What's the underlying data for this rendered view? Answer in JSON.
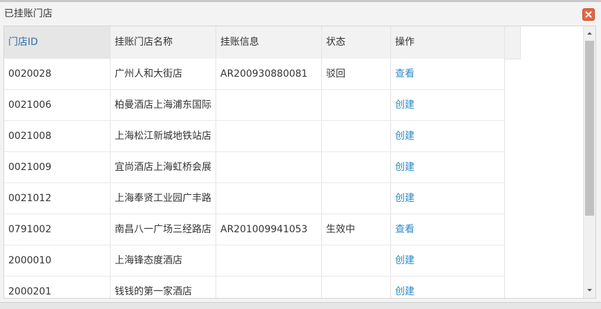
{
  "dialog": {
    "title": "已挂账门店",
    "close_icon": "close-icon",
    "accent_close": "#e8663e"
  },
  "table": {
    "columns": [
      "门店ID",
      "挂账门店名称",
      "挂账信息",
      "状态",
      "操作"
    ],
    "rows": [
      {
        "id": "0020028",
        "name": "广州人和大街店",
        "info": "AR200930880081",
        "status": "驳回",
        "action": "查看"
      },
      {
        "id": "0021006",
        "name": "柏曼酒店上海浦东国际",
        "info": "",
        "status": "",
        "action": "创建"
      },
      {
        "id": "0021008",
        "name": "上海松江新城地铁站店",
        "info": "",
        "status": "",
        "action": "创建"
      },
      {
        "id": "0021009",
        "name": "宜尚酒店上海虹桥会展",
        "info": "",
        "status": "",
        "action": "创建"
      },
      {
        "id": "0021012",
        "name": "上海奉贤工业园广丰路",
        "info": "",
        "status": "",
        "action": "创建"
      },
      {
        "id": "0791002",
        "name": "南昌八一广场三经路店",
        "info": "AR201009941053",
        "status": "生效中",
        "action": "查看"
      },
      {
        "id": "2000010",
        "name": "上海锋态度酒店",
        "info": "",
        "status": "",
        "action": "创建"
      },
      {
        "id": "2000201",
        "name": "钱钱的第一家酒店",
        "info": "",
        "status": "",
        "action": "创建"
      }
    ],
    "link_color": "#2e8bc7"
  }
}
